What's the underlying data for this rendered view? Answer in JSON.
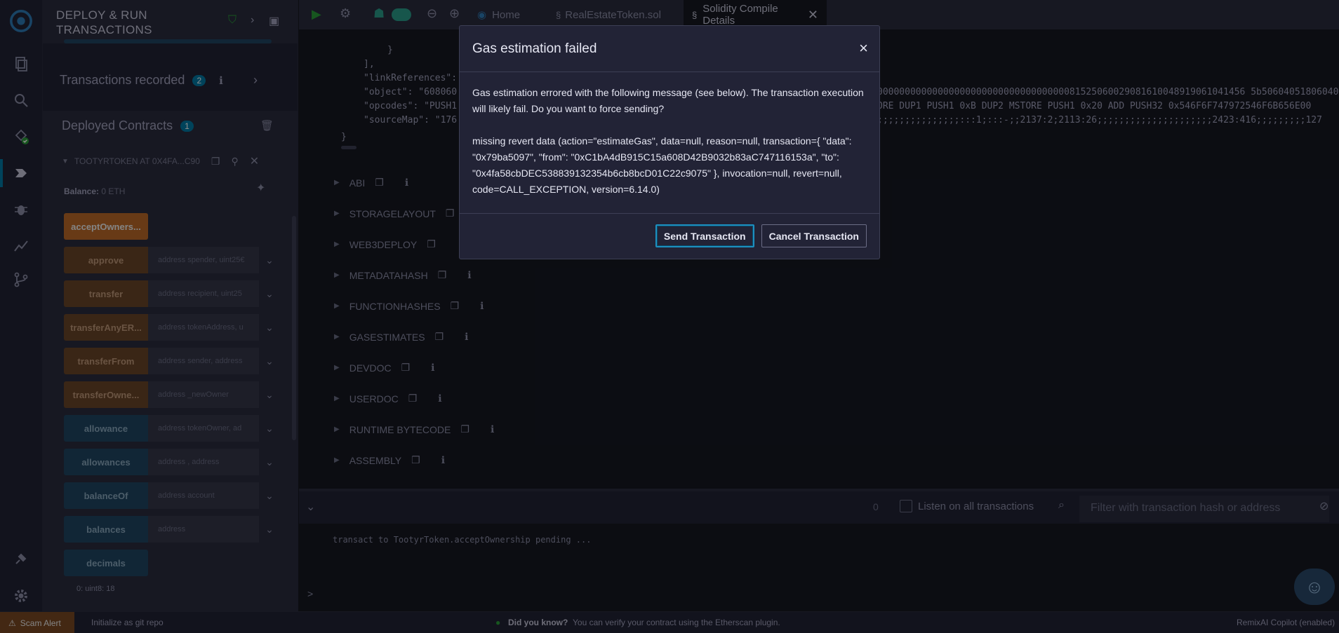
{
  "side_panel": {
    "title": "DEPLOY & RUN TRANSACTIONS",
    "transactions_recorded_label": "Transactions recorded",
    "transactions_recorded_count": "2",
    "deployed_contracts_label": "Deployed Contracts",
    "deployed_contracts_count": "1",
    "contract_name": "TOOTYRTOKEN AT 0X4FA...C90",
    "balance_label": "Balance:",
    "balance_value": "0 ETH",
    "functions": [
      {
        "label": "acceptOwners...",
        "placeholder": ""
      },
      {
        "label": "approve",
        "placeholder": "address spender, uint25€"
      },
      {
        "label": "transfer",
        "placeholder": "address recipient, uint25"
      },
      {
        "label": "transferAnyER...",
        "placeholder": "address tokenAddress, u"
      },
      {
        "label": "transferFrom",
        "placeholder": "address sender, address"
      },
      {
        "label": "transferOwne...",
        "placeholder": "address _newOwner"
      },
      {
        "label": "allowance",
        "placeholder": "address tokenOwner, ad"
      },
      {
        "label": "allowances",
        "placeholder": "address , address"
      },
      {
        "label": "balanceOf",
        "placeholder": "address account"
      },
      {
        "label": "balances",
        "placeholder": "address"
      },
      {
        "label": "decimals",
        "placeholder": ""
      }
    ],
    "decimals_output": "0: uint8: 18"
  },
  "tabs": [
    {
      "label": "Home"
    },
    {
      "label": "RealEstateToken.sol"
    },
    {
      "label": "Solidity Compile Details"
    }
  ],
  "code_lines": [
    "}",
    "],",
    "\"linkReferences\":",
    "\"object\": \"608060",
    "\"opcodes\": \"PUSH1",
    "\"sourceMap\": \"176",
    "}"
  ],
  "code_right": [
    "0000000000000000000000000000000000081525060029081610048919061041456 5b50604051806040",
    "ORE DUP1 PUSH1 0xB DUP2 MSTORE PUSH1 0x20 ADD PUSH32 0x546F6F747972546F6B656E00",
    ";;;;;;;;;;;;;;;:::1;:::-;;2137:2;2113:26;;;;;;;;;;;;;;;;;;;;;2423:416;;;;;;;;;127"
  ],
  "sections": [
    {
      "label": "ABI"
    },
    {
      "label": "STORAGELAYOUT"
    },
    {
      "label": "WEB3DEPLOY"
    },
    {
      "label": "METADATAHASH"
    },
    {
      "label": "FUNCTIONHASHES"
    },
    {
      "label": "GASESTIMATES"
    },
    {
      "label": "DEVDOC"
    },
    {
      "label": "USERDOC"
    },
    {
      "label": "RUNTIME BYTECODE"
    },
    {
      "label": "ASSEMBLY"
    }
  ],
  "terminal": {
    "count": "0",
    "listen_label": "Listen on all transactions",
    "filter_placeholder": "Filter with transaction hash or address",
    "log_line": "transact to TootyrToken.acceptOwnership pending ...",
    "prompt": ">"
  },
  "status_bar": {
    "scam_alert": "Scam Alert",
    "git_init": "Initialize as git repo",
    "tip_title": "Did you know?",
    "tip_text": "You can verify your contract using the Etherscan plugin.",
    "copilot": "RemixAI Copilot (enabled)"
  },
  "modal": {
    "title": "Gas estimation failed",
    "close": "×",
    "message": "Gas estimation errored with the following message (see below). The transaction execution will likely fail. Do you want to force sending?",
    "detail": "missing revert data (action=\"estimateGas\", data=null, reason=null, transaction={ \"data\": \"0x79ba5097\", \"from\": \"0xC1bA4dB915C15a608D42B9032b83aC747116153a\", \"to\": \"0x4fa58cbDEC538839132354b6cb8bcD01C22c9075\" }, invocation=null, revert=null, code=CALL_EXCEPTION, version=6.14.0)",
    "send_label": "Send Transaction",
    "cancel_label": "Cancel Transaction"
  },
  "colors": {
    "accent": "#007aa6",
    "background": "#161822",
    "panel": "#222336",
    "orange_button": "#bd6b29"
  }
}
